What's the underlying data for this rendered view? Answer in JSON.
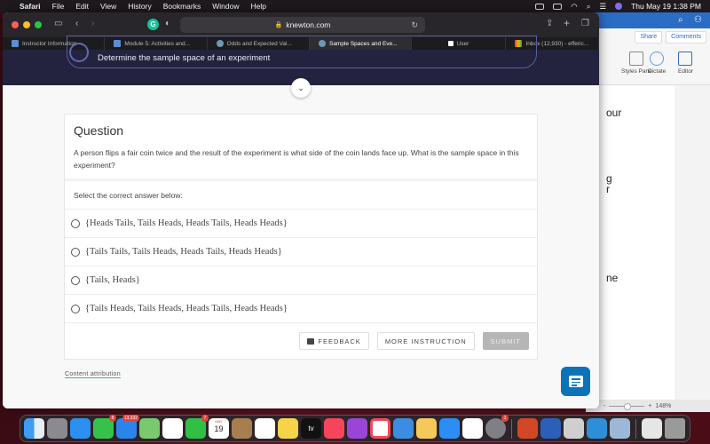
{
  "menubar": {
    "apple": "",
    "items": [
      "Safari",
      "File",
      "Edit",
      "View",
      "History",
      "Bookmarks",
      "Window",
      "Help"
    ],
    "datetime": "Thu May 19  1:38 PM"
  },
  "browser": {
    "url": "knewton.com",
    "tabs": [
      {
        "label": "Instructor Information -...",
        "icon": "knewton-icon",
        "active": false
      },
      {
        "label": "Module 5: Activities and...",
        "icon": "knewton-icon",
        "active": false
      },
      {
        "label": "Odds and Expected Val...",
        "icon": "gear-logo-icon",
        "active": false
      },
      {
        "label": "Sample Spaces and Eve...",
        "icon": "gear-logo-icon",
        "active": true
      },
      {
        "label": "User",
        "icon": "page-icon",
        "active": false
      },
      {
        "label": "Inbox (12,930) - efferic...",
        "icon": "gmail-icon",
        "active": false
      }
    ]
  },
  "page": {
    "objective": "Determine the sample space of an experiment",
    "question": {
      "title": "Question",
      "text": "A person flips a fair coin twice and the result of the experiment is what side of the coin lands face up. What is the sample space in this experiment?",
      "prompt": "Select the correct answer below:",
      "choices": [
        "{Heads Tails, Tails Heads, Heads Tails, Heads Heads}",
        "{Tails Tails, Tails Heads, Heads Tails, Heads Heads}",
        "{Tails, Heads}",
        "{Tails Heads, Tails Heads, Heads Tails, Heads Heads}"
      ]
    },
    "buttons": {
      "feedback": "FEEDBACK",
      "more_instruction": "MORE INSTRUCTION",
      "submit": "SUBMIT"
    },
    "attribution": "Content attribution"
  },
  "word": {
    "share": "Share",
    "comments": "Comments",
    "ribbon": [
      "Styles Pane",
      "Dictate",
      "Editor"
    ],
    "fragments": [
      "our",
      "g",
      "r",
      "ne"
    ],
    "zoom": "148%"
  },
  "dock": {
    "badges": {
      "messages": "8",
      "mail": "13,332",
      "facetime": "7",
      "settings": "1"
    },
    "calendar_day": "19"
  },
  "colors": {
    "banner": "#23233f",
    "chat_button": "#0c73b8",
    "submit_disabled": "#b6b6b6"
  }
}
